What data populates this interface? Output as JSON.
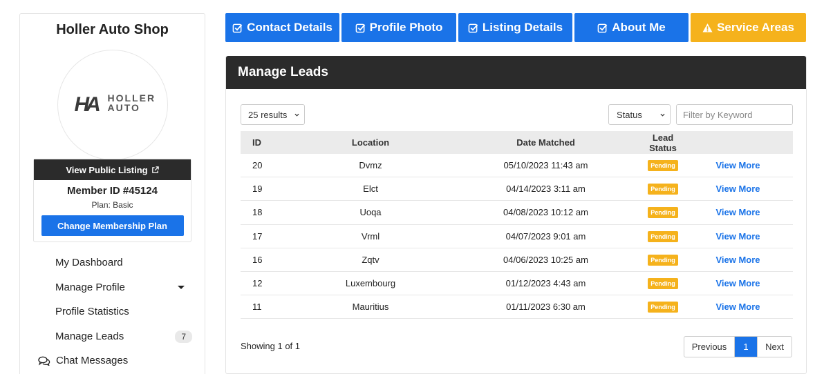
{
  "sidebar": {
    "shop_name": "Holler Auto Shop",
    "logo": {
      "mark": "HA",
      "line1": "HOLLER",
      "line2": "AUTO"
    },
    "view_public_label": "View Public Listing",
    "member_id": "Member ID #45124",
    "plan": "Plan: Basic",
    "change_plan_label": "Change Membership Plan",
    "nav": [
      {
        "label": "My Dashboard"
      },
      {
        "label": "Manage Profile"
      },
      {
        "label": "Profile Statistics"
      },
      {
        "label": "Manage Leads",
        "count": "7"
      },
      {
        "label": "Chat Messages"
      }
    ]
  },
  "tabs": [
    {
      "label": "Contact Details",
      "icon": "check-square-icon"
    },
    {
      "label": "Profile Photo",
      "icon": "check-square-icon"
    },
    {
      "label": "Listing Details",
      "icon": "check-square-icon"
    },
    {
      "label": "About Me",
      "icon": "check-square-icon"
    },
    {
      "label": "Service Areas",
      "icon": "warning-icon"
    }
  ],
  "colors": {
    "primary": "#1a73e8",
    "warning": "#f5b21c",
    "dark": "#2b2b2b"
  },
  "panel": {
    "title": "Manage Leads",
    "results_select": "25 results",
    "status_select": "Status",
    "filter_placeholder": "Filter by Keyword",
    "columns": [
      "ID",
      "Location",
      "Date Matched",
      "Lead Status"
    ],
    "rows": [
      {
        "id": "20",
        "location": "Dvmz",
        "date": "05/10/2023 11:43 am",
        "status": "Pending",
        "action": "View More"
      },
      {
        "id": "19",
        "location": "Elct",
        "date": "04/14/2023 3:11 am",
        "status": "Pending",
        "action": "View More"
      },
      {
        "id": "18",
        "location": "Uoqa",
        "date": "04/08/2023 10:12 am",
        "status": "Pending",
        "action": "View More"
      },
      {
        "id": "17",
        "location": "Vrml",
        "date": "04/07/2023 9:01 am",
        "status": "Pending",
        "action": "View More"
      },
      {
        "id": "16",
        "location": "Zqtv",
        "date": "04/06/2023 10:25 am",
        "status": "Pending",
        "action": "View More"
      },
      {
        "id": "12",
        "location": "Luxembourg",
        "date": "01/12/2023 4:43 am",
        "status": "Pending",
        "action": "View More"
      },
      {
        "id": "11",
        "location": "Mauritius",
        "date": "01/11/2023 6:30 am",
        "status": "Pending",
        "action": "View More"
      }
    ],
    "showing": "Showing 1 of 1",
    "pagination": {
      "prev": "Previous",
      "current": "1",
      "next": "Next"
    }
  }
}
